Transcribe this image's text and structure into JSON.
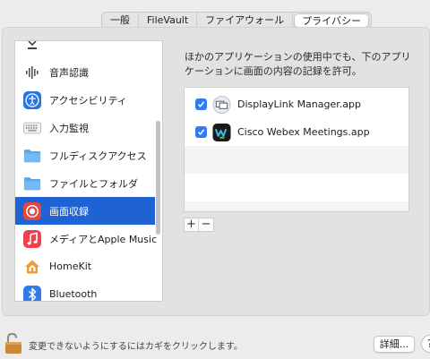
{
  "tabs": [
    {
      "label": "一般",
      "selected": false
    },
    {
      "label": "FileVault",
      "selected": false
    },
    {
      "label": "ファイアウォール",
      "selected": false
    },
    {
      "label": "プライバシー",
      "selected": true
    }
  ],
  "sidebar": {
    "items": [
      {
        "label": "",
        "icon": "input-monitoring-partial-icon"
      },
      {
        "label": "音声認識",
        "icon": "speech-waveform-icon"
      },
      {
        "label": "アクセシビリティ",
        "icon": "accessibility-icon"
      },
      {
        "label": "入力監視",
        "icon": "keyboard-icon"
      },
      {
        "label": "フルディスクアクセス",
        "icon": "folder-icon"
      },
      {
        "label": "ファイルとフォルダ",
        "icon": "folder-icon"
      },
      {
        "label": "画面収録",
        "icon": "screen-recording-icon",
        "selected": true
      },
      {
        "label": "メディアとApple Music",
        "icon": "music-note-icon"
      },
      {
        "label": "HomeKit",
        "icon": "home-icon"
      },
      {
        "label": "Bluetooth",
        "icon": "bluetooth-icon"
      }
    ]
  },
  "main": {
    "description": "ほかのアプリケーションの使用中でも、下のアプリケーションに画面の内容の記録を許可。",
    "apps": [
      {
        "name": "DisplayLink Manager.app",
        "checked": true,
        "icon": "displaylink-icon"
      },
      {
        "name": "Cisco Webex Meetings.app",
        "checked": true,
        "icon": "webex-icon"
      }
    ],
    "add_label": "+",
    "remove_label": "−"
  },
  "footer": {
    "lock_text": "変更できないようにするにはカギをクリックします。",
    "advanced_label": "詳細...",
    "help_label": "?"
  },
  "colors": {
    "selection": "#1f62d3",
    "checkbox": "#2f7cf6",
    "accessibility": "#2574e4",
    "screen_recording": "#e5473f",
    "music": "#f0414f",
    "home": "#f29b36",
    "bluetooth": "#2f7bea",
    "folder": "#5aa8ec"
  }
}
